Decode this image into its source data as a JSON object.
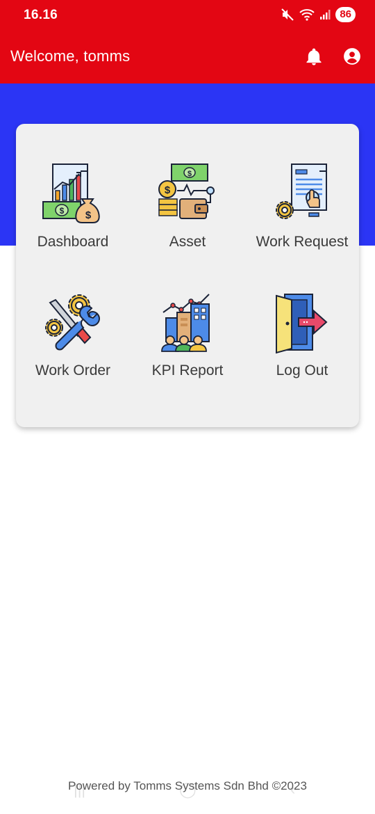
{
  "status_bar": {
    "time": "16.16",
    "battery": "86",
    "icons": [
      "mute-icon",
      "wifi-icon",
      "signal-icon",
      "battery-icon"
    ]
  },
  "app_bar": {
    "title": "Welcome, tomms",
    "icons": [
      "bell-icon",
      "account-icon"
    ]
  },
  "colors": {
    "header": "#e30613",
    "band": "#2b35f5",
    "card": "#f0f0f0"
  },
  "menu": {
    "dashboard": "Dashboard",
    "asset": "Asset",
    "work_request": "Work Request",
    "work_order": "Work Order",
    "kpi_report": "KPI Report",
    "log_out": "Log Out"
  },
  "footer": {
    "text": "Powered by Tomms Systems Sdn Bhd ©2023"
  }
}
